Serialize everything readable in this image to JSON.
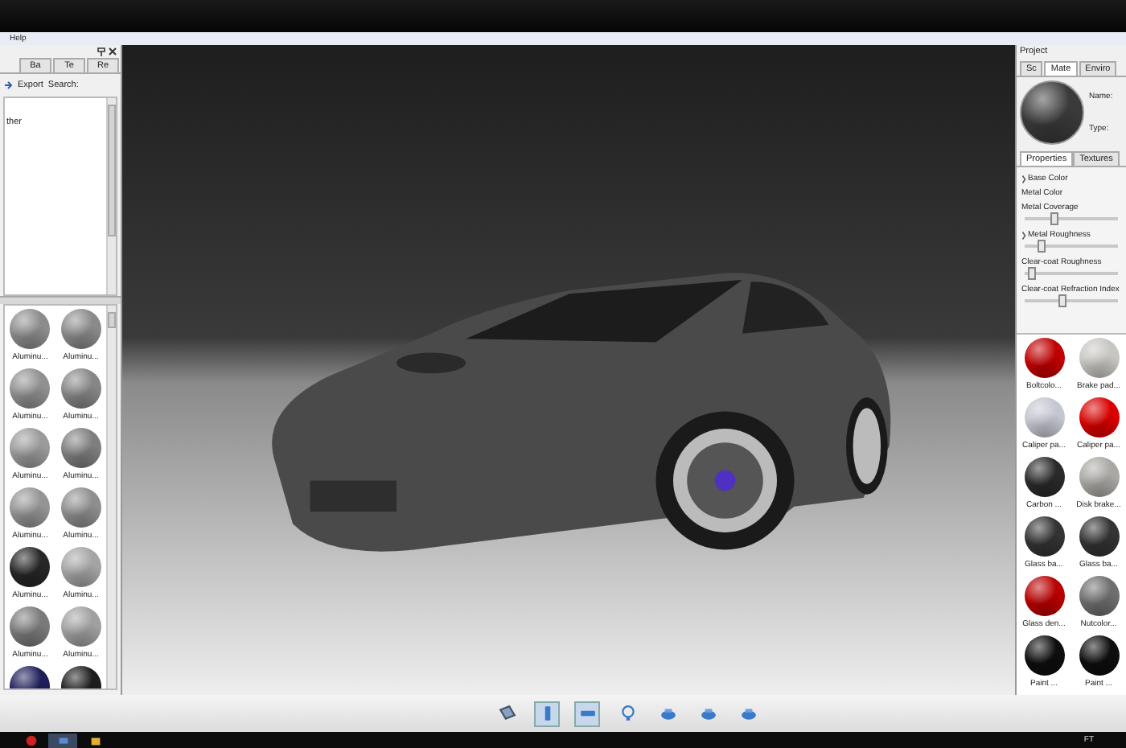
{
  "menu": [
    "Help"
  ],
  "library": {
    "tabs": [
      {
        "label": "Ba",
        "selected": false
      },
      {
        "label": "Te",
        "selected": false
      },
      {
        "label": "Re",
        "selected": false
      }
    ],
    "toolbar": [
      "Export",
      "Search:"
    ],
    "tree": [
      "ther"
    ],
    "materials": [
      {
        "label": "Aluminu...",
        "color": "#8c8c8c"
      },
      {
        "label": "Aluminu...",
        "color": "#8a8a8a"
      },
      {
        "label": "Aluminu...",
        "color": "#909090"
      },
      {
        "label": "Aluminu...",
        "color": "#868686"
      },
      {
        "label": "Aluminu...",
        "color": "#9a9a9a"
      },
      {
        "label": "Aluminu...",
        "color": "#7e7e7e"
      },
      {
        "label": "Aluminu...",
        "color": "#949494"
      },
      {
        "label": "Aluminu...",
        "color": "#8e8e8e"
      },
      {
        "label": "Aluminu...",
        "color": "#262626"
      },
      {
        "label": "Aluminu...",
        "color": "#a4a4a4"
      },
      {
        "label": "Aluminu...",
        "color": "#7a7a7a"
      },
      {
        "label": "Aluminu...",
        "color": "#a0a0a0"
      },
      {
        "color": "#1e1e5a"
      },
      {
        "color": "#1c1c1c"
      }
    ]
  },
  "project": {
    "title": "Project",
    "tabs": [
      {
        "label": "Sc",
        "selected": false
      },
      {
        "label": "Mate",
        "selected": true
      },
      {
        "label": "Enviro",
        "selected": false
      }
    ],
    "fields": [
      "Name:",
      "Type:"
    ],
    "subtabs": [
      {
        "label": "Properties",
        "selected": true
      },
      {
        "label": "Textures",
        "selected": false
      }
    ],
    "properties": [
      {
        "label": "Base Color",
        "caret": true
      },
      {
        "label": "Metal Color",
        "caret": false
      },
      {
        "label": "Metal Coverage",
        "caret": false,
        "level": 0.3
      },
      {
        "label": "Metal Roughness",
        "caret": true,
        "level": 0.15
      },
      {
        "label": "Clear-coat Roughness",
        "caret": false,
        "level": 0.03
      },
      {
        "label": "Clear-coat Refraction Index",
        "caret": false,
        "level": 0.4
      }
    ],
    "materials": [
      {
        "label": "Boltcolo...",
        "color": "#c00000"
      },
      {
        "label": "Brake pad...",
        "color": "#c8c6c2"
      },
      {
        "label": "Caliper pa...",
        "color": "#c4c6d0"
      },
      {
        "label": "Caliper pa...",
        "color": "#d80000"
      },
      {
        "label": "Carbon ...",
        "color": "#2a2a2a"
      },
      {
        "label": "Disk brake...",
        "color": "#aaa8a4"
      },
      {
        "label": "Glass ba...",
        "color": "#333333"
      },
      {
        "label": "Glass ba...",
        "color": "#333333"
      },
      {
        "label": "Glass den...",
        "color": "#b80000"
      },
      {
        "label": "Nutcolor...",
        "color": "#6e6e6e"
      },
      {
        "label": "Paint ...",
        "color": "#0e0e0e"
      },
      {
        "label": "Paint ...",
        "color": "#0e0e0e"
      }
    ]
  },
  "toolbar": [
    {
      "kind": "library",
      "selected": false
    },
    {
      "kind": "portrait",
      "selected": true
    },
    {
      "kind": "landscape",
      "selected": true
    },
    {
      "kind": "light",
      "selected": false
    },
    {
      "kind": "render",
      "selected": false
    },
    {
      "kind": "render",
      "selected": false
    },
    {
      "kind": "render",
      "selected": false
    }
  ],
  "taskbar": {
    "apps": [
      {
        "kind": "red",
        "selected": false
      },
      {
        "kind": "window",
        "selected": true
      },
      {
        "kind": "folder",
        "selected": false
      }
    ],
    "tray": "FT"
  }
}
